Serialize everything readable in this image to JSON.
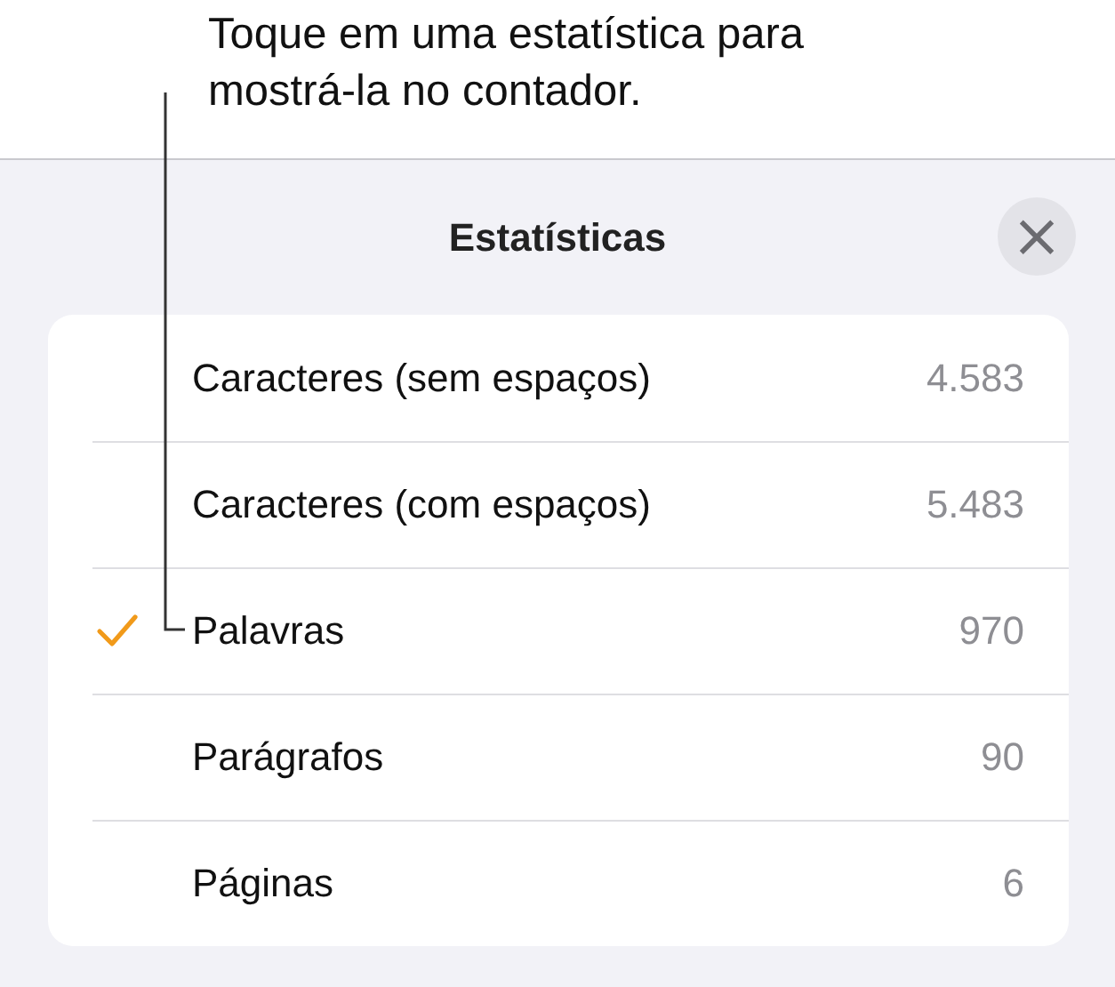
{
  "callout": {
    "text": "Toque em uma estatística para\nmostrá-la no contador."
  },
  "panel": {
    "title": "Estatísticas",
    "close": "×"
  },
  "rows": [
    {
      "label": "Caracteres (sem espaços)",
      "value": "4.583",
      "selected": false
    },
    {
      "label": "Caracteres (com espaços)",
      "value": "5.483",
      "selected": false
    },
    {
      "label": "Palavras",
      "value": "970",
      "selected": true
    },
    {
      "label": "Parágrafos",
      "value": "90",
      "selected": false
    },
    {
      "label": "Páginas",
      "value": "6",
      "selected": false
    }
  ]
}
